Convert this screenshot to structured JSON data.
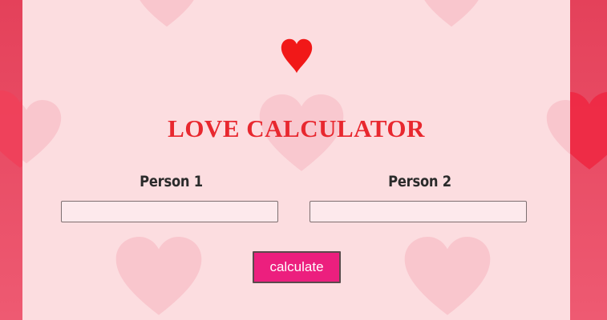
{
  "app": {
    "title": "LOVE CALCULATOR"
  },
  "form": {
    "person1_label": "Person 1",
    "person2_label": "Person 2",
    "person1_value": "",
    "person2_value": "",
    "calculate_label": "calculate"
  },
  "colors": {
    "background_side": "#e8475f",
    "panel_background": "#fcdde0",
    "title_red": "#e8282f",
    "heart_red": "#f11818",
    "button_pink": "#ec1f7e",
    "label_dark": "#2b2b2b"
  },
  "icons": {
    "header": "heart-icon",
    "decoration": "faded-heart-icon"
  }
}
